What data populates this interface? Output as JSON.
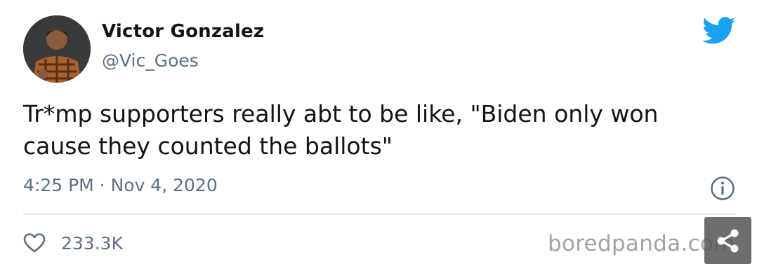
{
  "author": {
    "name": "Victor Gonzalez",
    "handle": "@Vic_Goes"
  },
  "tweet": {
    "text": "Tr*mp supporters really abt to be like, \"Biden only won cause they counted the ballots\"",
    "timestamp": "4:25 PM · Nov 4, 2020",
    "likes": "233.3K"
  },
  "icons": {
    "brand": "twitter-bird-icon",
    "info": "info-icon",
    "like": "heart-icon",
    "share": "share-icon"
  },
  "watermark": "boredpanda.com",
  "colors": {
    "text": "#0f1419",
    "secondary": "#5b7083",
    "twitter_blue": "#1da1f2",
    "divider": "#e1e8ed",
    "watermark": "#a3a3a3"
  }
}
